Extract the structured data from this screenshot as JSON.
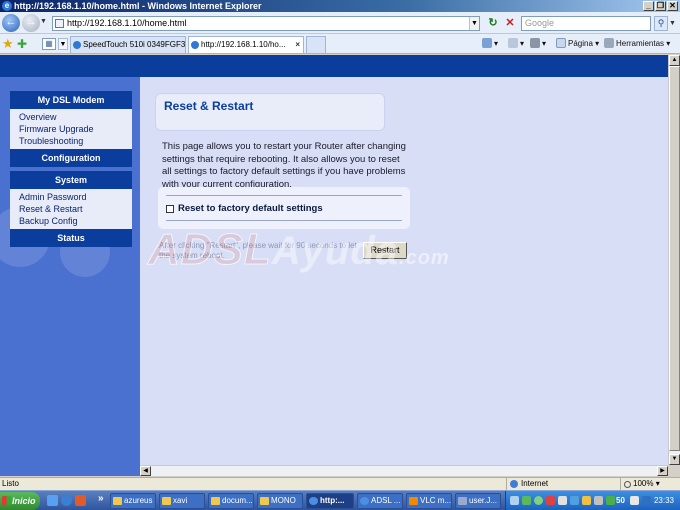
{
  "window": {
    "title": "http://192.168.1.10/home.html - Windows Internet Explorer",
    "controls": [
      "_",
      "❐",
      "✕"
    ]
  },
  "address_bar": {
    "url": "http://192.168.1.10/home.html",
    "search_placeholder": "Google"
  },
  "tabs": [
    {
      "label": "SpeedTouch 510i  0349FGF3G"
    },
    {
      "label": "http://192.168.1.10/ho..."
    }
  ],
  "command_bar": {
    "page_label": "Página",
    "tools_label": "Herramientas"
  },
  "sidebar": {
    "sections": [
      {
        "title": "My DSL Modem",
        "items": [
          "Overview",
          "Firmware Upgrade",
          "Troubleshooting"
        ]
      },
      {
        "title": "Configuration",
        "items": []
      },
      {
        "title": "System",
        "items": [
          "Admin Password",
          "Reset & Restart",
          "Backup Config"
        ]
      },
      {
        "title": "Status",
        "items": []
      }
    ]
  },
  "main": {
    "title": "Reset & Restart",
    "description": "This page allows you to restart your Router after changing settings that require rebooting. It also allows you to reset all settings to factory default settings if you have problems with your current configuration.",
    "checkbox_label": "Reset to factory default settings",
    "checkbox_checked": false,
    "hint": "After clicking \"Restart\", please wait for 90 seconds to let the system reboot.",
    "restart_button": "Restart"
  },
  "watermark": {
    "part1": "ADSL",
    "part2": "Ayuda",
    "part3": ".com"
  },
  "status_bar": {
    "status": "Listo",
    "zone": "Internet",
    "zoom": "100%"
  },
  "taskbar": {
    "start_label": "Inicio",
    "tasks": [
      {
        "label": "azureus",
        "icon": "folder"
      },
      {
        "label": "xavi",
        "icon": "folder"
      },
      {
        "label": "docum...",
        "icon": "folder"
      },
      {
        "label": "MONO",
        "icon": "folder"
      },
      {
        "label": "http:...",
        "icon": "ie",
        "active": true
      },
      {
        "label": "ADSL ...",
        "icon": "ie"
      },
      {
        "label": "VLC m...",
        "icon": "vlc"
      },
      {
        "label": "user.J...",
        "icon": "app"
      }
    ],
    "volume": "50",
    "clock": "23:33"
  },
  "colors": {
    "header_band": "#0a3d9c",
    "sidebar": "#4a70d0",
    "content_bg": "#d8def5",
    "title_text": "#0a3d9c"
  }
}
